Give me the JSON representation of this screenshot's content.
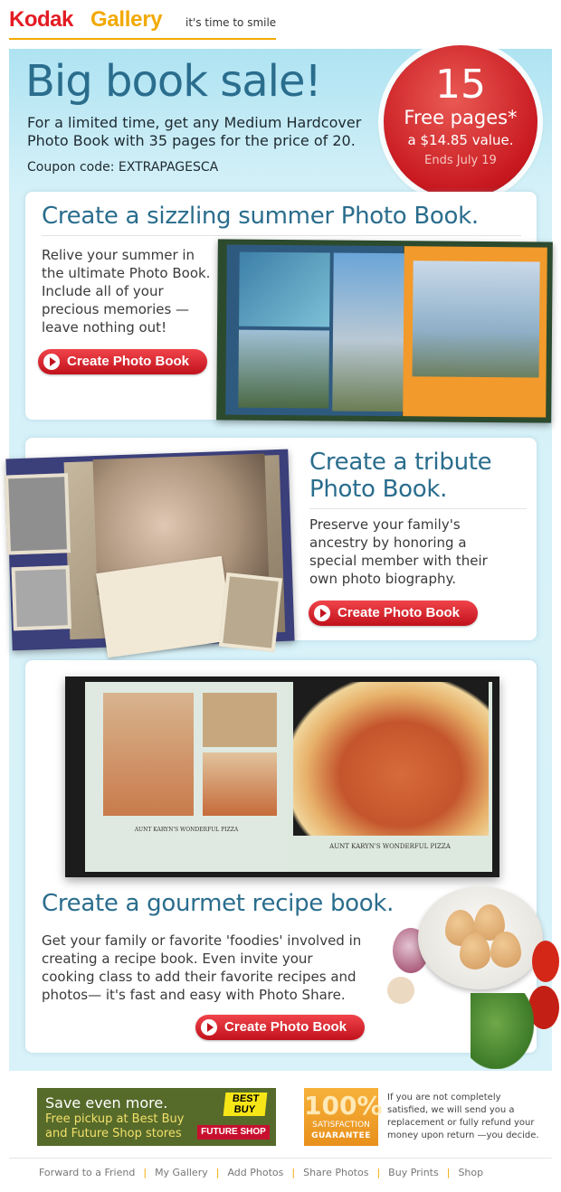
{
  "header": {
    "logo_kodak": "Kodak",
    "logo_gallery": "Gallery",
    "tagline": "it's time to smile"
  },
  "hero": {
    "title": "Big book sale!",
    "description": "For a limited time, get any Medium Hardcover Photo Book with 35 pages for the price of 20.",
    "coupon": "Coupon code: EXTRAPAGESCA"
  },
  "badge": {
    "number": "15",
    "free_pages": "Free pages*",
    "value": "a $14.85 value.",
    "ends": "Ends July 19"
  },
  "cards": [
    {
      "title": "Create a sizzling summer Photo Book.",
      "text": "Relive your summer in the ultimate Photo Book. Include all of your precious memories —leave nothing out!",
      "button": "Create Photo Book"
    },
    {
      "title": "Create a tribute Photo Book.",
      "text": "Preserve your family's ancestry by honoring a special member with their own photo biography.",
      "button": "Create Photo Book"
    },
    {
      "title": "Create a gourmet recipe book.",
      "text": "Get your family or favorite 'foodies' involved in creating a recipe book. Even invite your cooking class to add their favorite recipes and photos— it's fast and easy with Photo Share.",
      "button": "Create Photo Book",
      "book_caption_left": "AUNT KARYN'S WONDERFUL PIZZA",
      "book_caption_right": "AUNT KARYN'S WONDERFUL PIZZA"
    }
  ],
  "bestbuy": {
    "title": "Save even more.",
    "subtitle": "Free pickup at Best Buy and Future Shop stores",
    "logo_bestbuy": "BEST BUY",
    "logo_futureshop": "FUTURE SHOP"
  },
  "guarantee": {
    "number": "100%",
    "label1": "SATISFACTION",
    "label2": "GUARANTEE",
    "text": "If you are not completely satisfied, we will send you a replacement or fully refund your money upon return —you decide."
  },
  "footer": {
    "links": [
      "Forward to a Friend",
      "My Gallery",
      "Add Photos",
      "Share Photos",
      "Buy Prints",
      "Shop"
    ]
  },
  "colors": {
    "kodak_red": "#e31b23",
    "kodak_yellow": "#f2a900",
    "heading_blue": "#2a6d8d",
    "panel_blue": "#d6f1f8",
    "button_red": "#c1121c"
  }
}
